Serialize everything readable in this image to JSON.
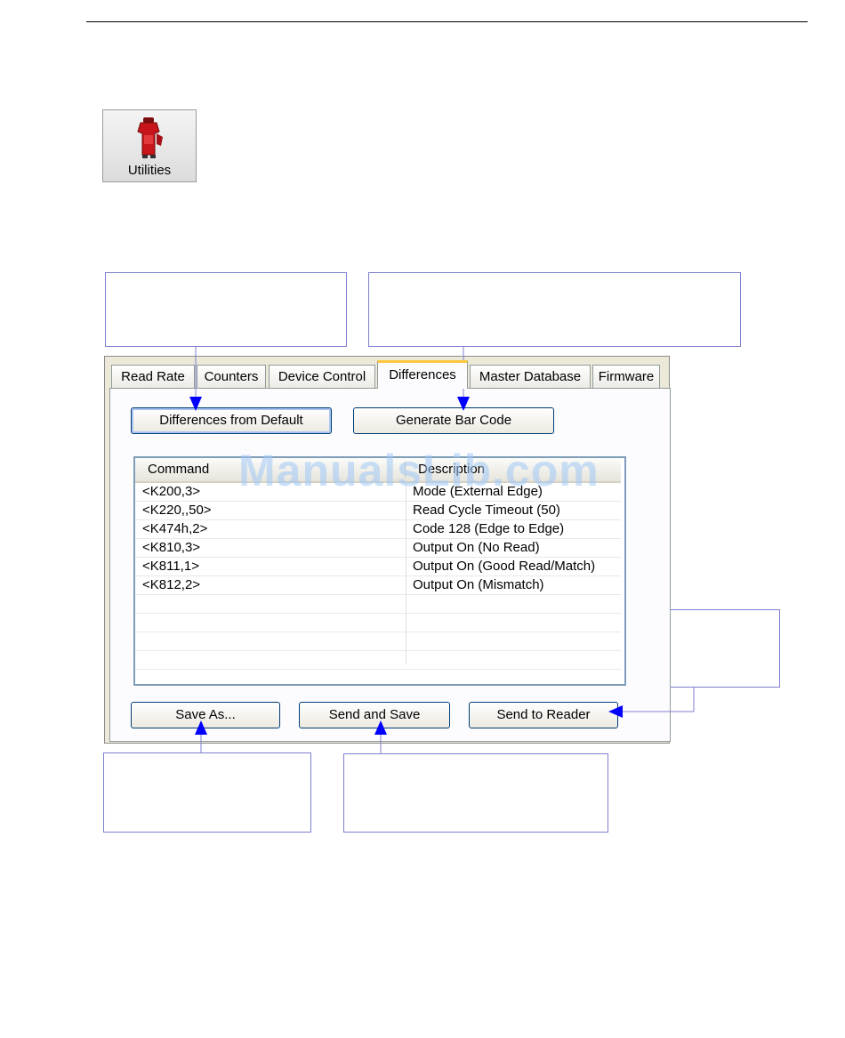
{
  "utilities": {
    "label": "Utilities",
    "icon": "utilities-icon"
  },
  "tabs": [
    {
      "label": "Read Rate",
      "active": false
    },
    {
      "label": "Counters",
      "active": false
    },
    {
      "label": "Device Control",
      "active": false
    },
    {
      "label": "Differences",
      "active": true
    },
    {
      "label": "Master Database",
      "active": false
    },
    {
      "label": "Firmware",
      "active": false
    }
  ],
  "buttons": {
    "differences_from_default": "Differences from Default",
    "generate_bar_code": "Generate Bar Code",
    "save_as": "Save As...",
    "send_and_save": "Send and Save",
    "send_to_reader": "Send to Reader"
  },
  "table": {
    "columns": [
      "Command",
      "Description"
    ],
    "rows": [
      {
        "command": "<K200,3>",
        "description": "Mode (External Edge)"
      },
      {
        "command": "<K220,,50>",
        "description": "Read Cycle Timeout (50)"
      },
      {
        "command": "<K474h,2>",
        "description": "Code 128 (Edge to Edge)"
      },
      {
        "command": "<K810,3>",
        "description": "Output On (No Read)"
      },
      {
        "command": "<K811,1>",
        "description": "Output On (Good Read/Match)"
      },
      {
        "command": "<K812,2>",
        "description": "Output On (Mismatch)"
      },
      {
        "command": "",
        "description": ""
      },
      {
        "command": "",
        "description": ""
      },
      {
        "command": "",
        "description": ""
      },
      {
        "command": "",
        "description": ""
      }
    ]
  },
  "watermark": "ManualsLib.com",
  "colors": {
    "accent": "#0000ff",
    "callout_border": "#7f7fd0",
    "tab_highlight": "#ffc83c"
  }
}
